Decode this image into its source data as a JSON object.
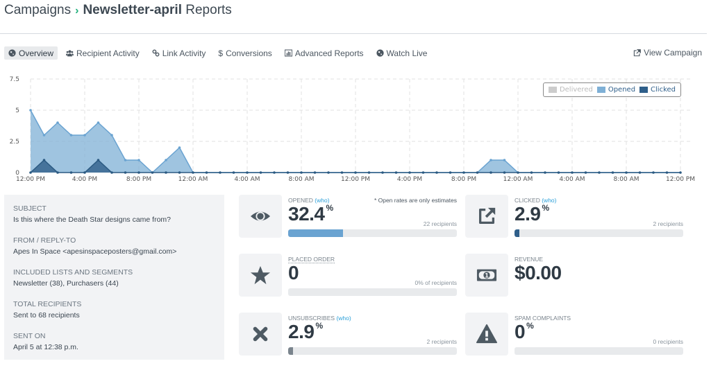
{
  "header": {
    "parent": "Campaigns",
    "separator": "›",
    "campaign_name": "Newsletter-april",
    "suffix": "Reports"
  },
  "tabs": [
    {
      "label": "Overview",
      "icon": "globe-icon",
      "active": true
    },
    {
      "label": "Recipient Activity",
      "icon": "users-icon",
      "active": false
    },
    {
      "label": "Link Activity",
      "icon": "link-icon",
      "active": false
    },
    {
      "label": "Conversions",
      "icon": "dollar-icon",
      "active": false
    },
    {
      "label": "Advanced Reports",
      "icon": "bar-chart-icon",
      "active": false
    },
    {
      "label": "Watch Live",
      "icon": "globe-icon",
      "active": false
    }
  ],
  "view_campaign": {
    "label": "View Campaign",
    "icon": "external-link-icon"
  },
  "legend": [
    {
      "label": "Delivered",
      "color": "#cccccc",
      "text_color": "#bbbbbb"
    },
    {
      "label": "Opened",
      "color": "#7fb0d6",
      "text_color": "#2f5f8a"
    },
    {
      "label": "Clicked",
      "color": "#2f5f8a",
      "text_color": "#2f5f8a"
    }
  ],
  "chart_data": {
    "type": "area",
    "title": "",
    "xlabel": "",
    "ylabel": "",
    "ylim": [
      0,
      7.5
    ],
    "yticks": [
      "0",
      "2.5",
      "5",
      "7.5"
    ],
    "ytick_values": [
      0,
      2.5,
      5,
      7.5
    ],
    "x_interval_hours": 1,
    "x_start": "12:00 PM",
    "xtick_labels": [
      "12:00 PM",
      "4:00 PM",
      "8:00 PM",
      "12:00 AM",
      "4:00 AM",
      "8:00 AM",
      "12:00 PM",
      "4:00 PM",
      "8:00 PM",
      "12:00 AM",
      "4:00 AM",
      "8:00 AM",
      "12:00 PM"
    ],
    "xtick_every_n_points": 4,
    "grid": true,
    "legend_position": "top-right",
    "series": [
      {
        "name": "Delivered",
        "color": "#cccccc",
        "values": []
      },
      {
        "name": "Opened",
        "color": "#7fb0d6",
        "values": [
          5,
          3,
          4,
          3,
          3,
          4,
          3,
          1,
          1,
          0,
          1,
          2,
          0,
          0,
          0,
          0,
          0,
          0,
          0,
          0,
          0,
          0,
          0,
          0,
          0,
          0,
          0,
          0,
          0,
          0,
          0,
          0,
          0,
          0,
          1,
          1,
          0,
          0,
          0,
          0,
          0,
          0,
          0,
          0,
          0,
          0,
          0,
          0,
          0
        ]
      },
      {
        "name": "Clicked",
        "color": "#2f5f8a",
        "values": [
          0,
          1,
          0,
          0,
          0,
          1,
          0,
          0,
          0,
          0,
          0,
          0,
          0,
          0,
          0,
          0,
          0,
          0,
          0,
          0,
          0,
          0,
          0,
          0,
          0,
          0,
          0,
          0,
          0,
          0,
          0,
          0,
          0,
          0,
          0,
          0,
          0,
          0,
          0,
          0,
          0,
          0,
          0,
          0,
          0,
          0,
          0,
          0,
          0
        ]
      }
    ]
  },
  "info": [
    {
      "label": "Subject",
      "value": "Is this where the Death Star designs came from?"
    },
    {
      "label": "From / Reply-To",
      "value": "Apes In Space <apesinspaceposters@gmail.com>"
    },
    {
      "label": "Included Lists and Segments",
      "value": "Newsletter (38), Purchasers (44)"
    },
    {
      "label": "Total Recipients",
      "value": "Sent to 68 recipients"
    },
    {
      "label": "Sent On",
      "value": "April 5 at 12:38 p.m."
    }
  ],
  "stats": {
    "opened": {
      "title": "Opened",
      "who": "(who)",
      "value": "32.4",
      "unit": "%",
      "note": "* Open rates are only estimates",
      "recipients": "22 recipients",
      "progress_percent": 32.4,
      "bar_color": "#6aa3d1",
      "icon": "eye-icon"
    },
    "clicked": {
      "title": "Clicked",
      "who": "(who)",
      "value": "2.9",
      "unit": "%",
      "recipients": "2 recipients",
      "progress_percent": 2.9,
      "bar_color": "#2f5f8a",
      "icon": "external-link-icon"
    },
    "placed_order": {
      "title": "Placed Order",
      "value": "0",
      "recipients": "0% of recipients",
      "progress_percent": 0,
      "icon": "star-icon"
    },
    "revenue": {
      "title": "Revenue",
      "value": "$0.00",
      "icon": "money-icon"
    },
    "unsubscribes": {
      "title": "Unsubscribes",
      "who": "(who)",
      "value": "2.9",
      "unit": "%",
      "recipients": "2 recipients",
      "progress_percent": 2.9,
      "bar_color": "#7a848d",
      "icon": "x-icon"
    },
    "spam": {
      "title": "Spam Complaints",
      "value": "0",
      "unit": "%",
      "recipients": "0 recipients",
      "progress_percent": 0,
      "icon": "warning-icon"
    }
  }
}
